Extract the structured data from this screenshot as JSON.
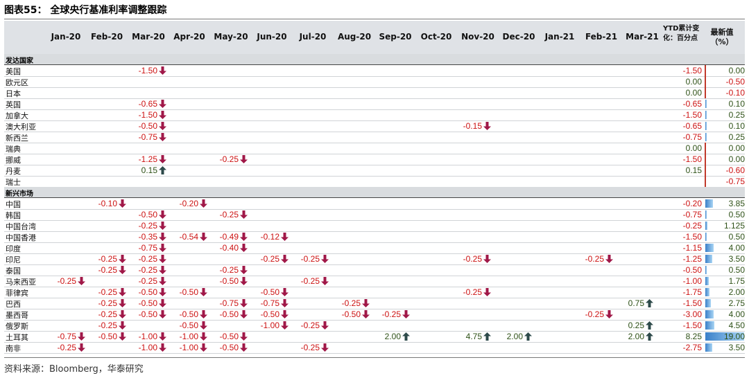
{
  "title": "图表55：   全球央行基准利率调整跟踪",
  "header": {
    "months": [
      "Jan-20",
      "Feb-20",
      "Mar-20",
      "Apr-20",
      "May-20",
      "Jun-20",
      "Jul-20",
      "Aug-20",
      "Sep-20",
      "Oct-20",
      "Nov-20",
      "Dec-20",
      "Jan-21",
      "Feb-21",
      "Mar-21"
    ],
    "ytd_label": "YTD累计变化：百分点",
    "latest_label": "最新值（%）"
  },
  "colors": {
    "negative": "#cc1111",
    "positive": "#2d5016",
    "arrow_down": "#a01848",
    "arrow_up": "#2d4a4a",
    "bar": "#3a80c9",
    "divider": "#c0392b"
  },
  "sections": [
    {
      "name": "发达国家",
      "rows": [
        {
          "country": "美国",
          "changes": {
            "2": "-1.50"
          },
          "ytd": "-1.50",
          "latest": "0.00"
        },
        {
          "country": "欧元区",
          "changes": {},
          "ytd": "0.00",
          "latest": "-0.50"
        },
        {
          "country": "日本",
          "changes": {},
          "ytd": "0.00",
          "latest": "-0.10"
        },
        {
          "country": "英国",
          "changes": {
            "2": "-0.65"
          },
          "ytd": "-0.65",
          "latest": "0.10"
        },
        {
          "country": "加拿大",
          "changes": {
            "2": "-1.50"
          },
          "ytd": "-1.50",
          "latest": "0.25"
        },
        {
          "country": "澳大利亚",
          "changes": {
            "2": "-0.50",
            "10": "-0.15"
          },
          "ytd": "-0.65",
          "latest": "0.10"
        },
        {
          "country": "新西兰",
          "changes": {
            "2": "-0.75"
          },
          "ytd": "-0.75",
          "latest": "0.25"
        },
        {
          "country": "瑞典",
          "changes": {},
          "ytd": "0.00",
          "latest": "0.00"
        },
        {
          "country": "挪威",
          "changes": {
            "2": "-1.25",
            "4": "-0.25"
          },
          "ytd": "-1.50",
          "latest": "0.00"
        },
        {
          "country": "丹麦",
          "changes": {
            "2": "0.15"
          },
          "ytd": "0.15",
          "latest": "-0.60"
        },
        {
          "country": "瑞士",
          "changes": {},
          "ytd": "",
          "latest": "-0.75"
        }
      ]
    },
    {
      "name": "新兴市场",
      "rows": [
        {
          "country": "中国",
          "changes": {
            "1": "-0.10",
            "3": "-0.20"
          },
          "ytd": "-0.20",
          "latest": "3.85"
        },
        {
          "country": "韩国",
          "changes": {
            "2": "-0.50",
            "4": "-0.25"
          },
          "ytd": "-0.75",
          "latest": "0.50"
        },
        {
          "country": "中国台湾",
          "changes": {
            "2": "-0.25"
          },
          "ytd": "-0.25",
          "latest": "1.125"
        },
        {
          "country": "中国香港",
          "changes": {
            "2": "-0.35",
            "3": "-0.54",
            "4": "-0.49",
            "5": "-0.12"
          },
          "ytd": "-1.50",
          "latest": "0.50"
        },
        {
          "country": "印度",
          "changes": {
            "2": "-0.75",
            "4": "-0.40"
          },
          "ytd": "-1.15",
          "latest": "4.00"
        },
        {
          "country": "印尼",
          "changes": {
            "1": "-0.25",
            "2": "-0.25",
            "5": "-0.25",
            "6": "-0.25",
            "10": "-0.25",
            "13": "-0.25"
          },
          "ytd": "-1.25",
          "latest": "3.50"
        },
        {
          "country": "泰国",
          "changes": {
            "1": "-0.25",
            "2": "-0.25",
            "4": "-0.25"
          },
          "ytd": "-0.50",
          "latest": "0.50"
        },
        {
          "country": "马来西亚",
          "changes": {
            "0": "-0.25",
            "2": "-0.25",
            "4": "-0.50",
            "6": "-0.25"
          },
          "ytd": "-1.00",
          "latest": "1.75"
        },
        {
          "country": "菲律宾",
          "changes": {
            "1": "-0.25",
            "2": "-0.50",
            "3": "-0.50",
            "5": "-0.50",
            "10": "-0.25"
          },
          "ytd": "-1.75",
          "latest": "2.00"
        },
        {
          "country": "巴西",
          "changes": {
            "1": "-0.25",
            "2": "-0.50",
            "4": "-0.75",
            "5": "-0.75",
            "7": "-0.25",
            "14": "0.75"
          },
          "ytd": "-1.50",
          "latest": "2.75"
        },
        {
          "country": "墨西哥",
          "changes": {
            "1": "-0.25",
            "2": "-0.50",
            "3": "-0.50",
            "4": "-0.50",
            "5": "-0.50",
            "7": "-0.50",
            "8": "-0.25",
            "13": "-0.25"
          },
          "ytd": "-3.00",
          "latest": "4.00"
        },
        {
          "country": "俄罗斯",
          "changes": {
            "1": "-0.25",
            "3": "-0.50",
            "5": "-1.00",
            "6": "-0.25",
            "14": "0.25"
          },
          "ytd": "-1.50",
          "latest": "4.50"
        },
        {
          "country": "土耳其",
          "changes": {
            "0": "-0.75",
            "1": "-0.50",
            "2": "-1.00",
            "3": "-1.00",
            "4": "-0.50",
            "8": "2.00",
            "10": "4.75",
            "11": "2.00",
            "14": "2.00"
          },
          "ytd": "8.25",
          "latest": "19.00"
        },
        {
          "country": "南非",
          "changes": {
            "0": "-0.25",
            "2": "-1.00",
            "3": "-1.00",
            "4": "-0.50",
            "6": "-0.25"
          },
          "ytd": "-2.75",
          "latest": "3.50"
        }
      ]
    }
  ],
  "source": "资料来源：Bloomberg，华泰研究"
}
